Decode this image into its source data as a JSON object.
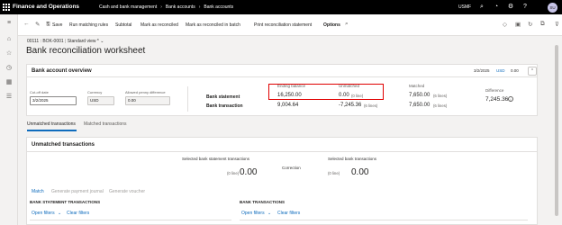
{
  "topbar": {
    "app_title": "Finance and Operations",
    "breadcrumbs": [
      "Cash and bank management",
      "Bank accounts",
      "Bank accounts"
    ],
    "company": "USMF",
    "avatar_initials": "SU",
    "icons": [
      "waffle-icon",
      "search-icon",
      "notification-icon",
      "settings-icon",
      "help-icon"
    ]
  },
  "rail": {
    "icons": [
      "hamburger-icon",
      "home-icon",
      "star-icon",
      "clock-icon",
      "table-icon",
      "list-icon"
    ]
  },
  "actionpane": {
    "back_icon": "back-arrow-icon",
    "edit_icon": "edit-icon",
    "save": "Save",
    "run_matching_rules": "Run matching rules",
    "subtotal": "Subtotal",
    "mark_as_reconciled": "Mark as reconciled",
    "mark_as_reconciled_in_batch": "Mark as reconciled in batch",
    "print_reconciliation_statement": "Print reconciliation statement",
    "options": "Options",
    "search_icon": "search-icon"
  },
  "header": {
    "record": "00111 : BOK-0001",
    "view": "Standard view *",
    "title": "Bank reconciliation worksheet"
  },
  "overview": {
    "title": "Bank account overview",
    "date": "3/2/2025",
    "currency": "USD",
    "amount": "0.00",
    "cutoff_label": "Cut-off date",
    "cutoff_value": "3/2/2025",
    "currency_label": "Currency",
    "currency_value": "USD",
    "penny_label": "Allowed penny difference",
    "penny_value": "0.00",
    "col_ending_balance": "Ending balance",
    "col_unmatched": "Unmatched",
    "col_matched": "Matched",
    "col_difference": "Difference",
    "row_bank_statement": "Bank statement",
    "row_bank_transaction": "Bank transaction",
    "bs_ending": "16,250.00",
    "bs_unmatched": "0.00",
    "bs_unmatched_lines": "(0 line)",
    "bs_matched": "7,650.00",
    "bs_matched_lines": "(6 lines)",
    "bt_ending": "9,004.64",
    "bt_unmatched": "-7,245.36",
    "bt_unmatched_lines": "(6 lines)",
    "bt_matched": "7,650.00",
    "bt_matched_lines": "(6 lines)",
    "difference": "7,245.36"
  },
  "tabs": {
    "unmatched": "Unmatched transactions",
    "matched": "Matched transactions"
  },
  "unmatched": {
    "title": "Unmatched transactions",
    "sel_stmt_label": "Selected bank statement transactions",
    "sel_stmt_lines": "(0 line)",
    "sel_stmt_value": "0.00",
    "correction_label": "Correction",
    "sel_bank_label": "Selected bank transactions",
    "sel_bank_lines": "(0 line)",
    "sel_bank_value": "0.00",
    "match": "Match",
    "generate_payment_journal": "Generate payment journal",
    "generate_voucher": "Generate voucher",
    "bst_header": "BANK STATEMENT TRANSACTIONS",
    "bt_header": "BANK TRANSACTIONS",
    "open_filters": "Open filters",
    "clear_filters": "Clear filters"
  }
}
